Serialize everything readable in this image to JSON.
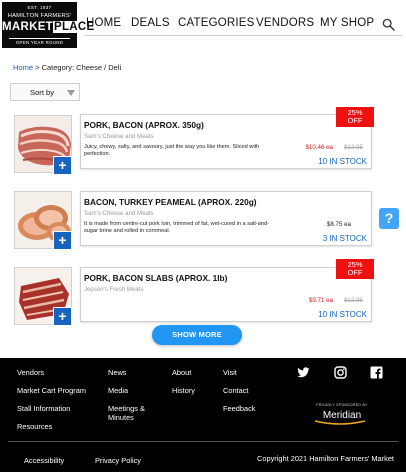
{
  "logo": {
    "est": "EST. 1837",
    "hamilton": "HAMILTON FARMERS'",
    "market": "MARKET",
    "place": "PLACE",
    "open": "OPEN YEAR ROUND"
  },
  "nav": [
    "HOME",
    "DEALS",
    "CATEGORIES",
    "VENDORS",
    "MY SHOP"
  ],
  "breadcrumb": {
    "home": "Home",
    "rest": " > Category: Cheese / Deli"
  },
  "sort": {
    "label": "Sort by"
  },
  "products": [
    {
      "name": "PORK, BACON (APROX. 350g)",
      "vendor": "Sam's Cheese and Meats",
      "description": "Juicy, chewy, salty, and savoury, just the way you like them. Sliced with perfection.",
      "price": "$10.46 ea",
      "old_price": "$13.95",
      "stock": "10 IN STOCK",
      "badge": {
        "pct": "25%",
        "off": "OFF"
      }
    },
    {
      "name": "BACON, TURKEY PEAMEAL (APROX. 220g)",
      "vendor": "Sam's Cheese and Meats",
      "description": "It is made from centre-cut pork loin, trimmed of fat, wet-cured in a salt-and-sugar brine and rolled in cornmeal.",
      "price": "$8.75 ea",
      "stock": "3 IN STOCK"
    },
    {
      "name": "PORK, BACON SLABS (APROX. 1lb)",
      "vendor": "Jepson's Fresh Meats",
      "description": "",
      "price": "$9.71 ea",
      "old_price": "$12.95",
      "stock": "10 IN STOCK",
      "badge": {
        "pct": "25%",
        "off": "OFF"
      }
    }
  ],
  "add_button": "+",
  "help_button": "?",
  "show_more": "SHOW MORE",
  "footer": {
    "col1": [
      "Vendors",
      "Market Cart Program",
      "Stall Information",
      "Resources"
    ],
    "col2": [
      "News",
      "Media",
      "Meetings &",
      "Minutes"
    ],
    "col3": [
      "About",
      "History"
    ],
    "col4": [
      "Visit",
      "Contact",
      "Feedback"
    ],
    "social": [
      "twitter-icon",
      "instagram-icon",
      "facebook-icon"
    ],
    "sponsor_label": "PROUDLY SPONSORED BY",
    "sponsor_name": "Meridian",
    "bottom_links": [
      "Accessibility",
      "Privacy Policy"
    ],
    "copyright": "Copyright 2021 Hamilton Farmers' Market"
  },
  "colors": {
    "accent": "#1565c0",
    "sale": "#d81b1b",
    "badge": "#ef1111",
    "button": "#2196f3"
  }
}
